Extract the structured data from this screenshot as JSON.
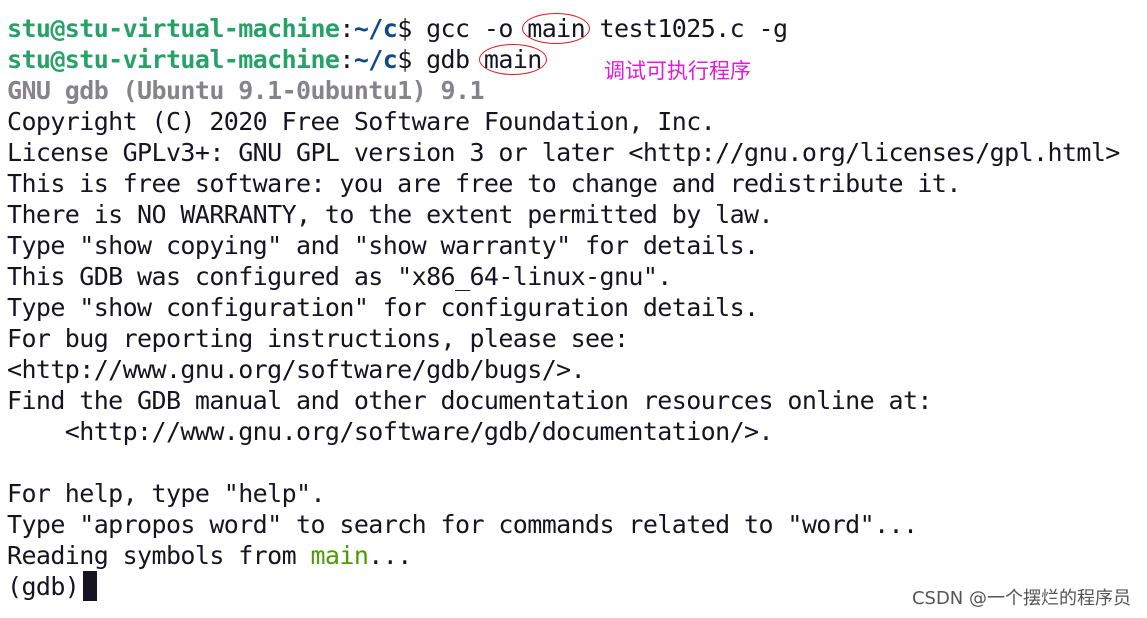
{
  "prompt": {
    "user_host": "stu@stu-virtual-machine",
    "sep": ":",
    "path": "~/c",
    "symbol": "$"
  },
  "commands": [
    {
      "pre": "gcc -o",
      "target": "main",
      "post": "test1025.c -g"
    },
    {
      "pre": "gdb",
      "target": "main",
      "post": ""
    }
  ],
  "annotation": "调试可执行程序",
  "gdb": {
    "version_line": "GNU gdb (Ubuntu 9.1-0ubuntu1) 9.1",
    "lines": [
      "Copyright (C) 2020 Free Software Foundation, Inc.",
      "License GPLv3+: GNU GPL version 3 or later <http://gnu.org/licenses/gpl.html>",
      "This is free software: you are free to change and redistribute it.",
      "There is NO WARRANTY, to the extent permitted by law.",
      "Type \"show copying\" and \"show warranty\" for details.",
      "This GDB was configured as \"x86_64-linux-gnu\".",
      "Type \"show configuration\" for configuration details.",
      "For bug reporting instructions, please see:",
      "<http://www.gnu.org/software/gdb/bugs/>.",
      "Find the GDB manual and other documentation resources online at:",
      "    <http://www.gnu.org/software/gdb/documentation/>.",
      "",
      "For help, type \"help\".",
      "Type \"apropos word\" to search for commands related to \"word\"..."
    ],
    "reading_prefix": "Reading symbols from ",
    "reading_file": "main",
    "reading_suffix": "...",
    "prompt": "(gdb)"
  },
  "watermark": "CSDN @一个摆烂的程序员"
}
